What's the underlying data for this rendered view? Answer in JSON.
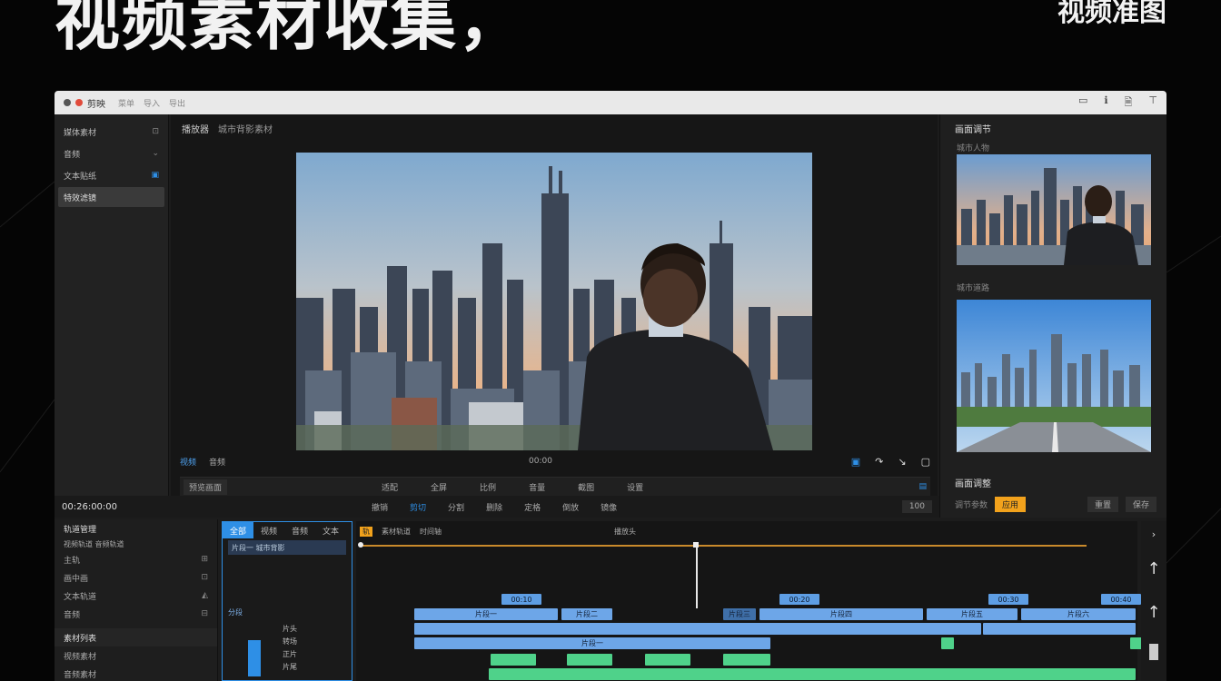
{
  "headline": "视频素材收集，",
  "corner_tag": "视频准图",
  "titlebar": {
    "app_name": "剪映",
    "menus": [
      "菜单",
      "导入",
      "导出"
    ],
    "right_icons": [
      "window-icon",
      "info-icon",
      "save-icon",
      "pin-icon"
    ]
  },
  "sidebar": {
    "items": [
      {
        "label": "媒体素材",
        "right": "⊡"
      },
      {
        "label": "音频",
        "right": "⌄"
      },
      {
        "label": "文本贴纸",
        "right": "▣"
      },
      {
        "label": "特效滤镜",
        "right": ""
      }
    ]
  },
  "preview": {
    "title": "播放器",
    "subtitle": "城市背影素材",
    "tab_active": "视频",
    "tab_other": "音频",
    "strip_label": "预览画面",
    "controls": [
      "适配",
      "全屏",
      "比例",
      "音量",
      "截图",
      "设置"
    ],
    "timecode_center": "00:00"
  },
  "right_panel": {
    "title": "画面调节",
    "thumb1_label": "城市人物",
    "thumb2_label": "城市道路",
    "bottom_title": "画面调整",
    "bottom_label": "调节参数",
    "bottom_btn_yellow": "应用",
    "bottom_btn_a": "重置",
    "bottom_btn_b": "保存"
  },
  "timeline_header": {
    "timecode": "00:26:00:00",
    "controls": [
      "撤销",
      "剪切",
      "分割",
      "删除",
      "定格",
      "倒放",
      "镜像"
    ],
    "volume": "100"
  },
  "tracks_left": {
    "head": "轨道管理",
    "subhead": "视频轨道 音频轨道",
    "rows": [
      {
        "label": "主轨",
        "right": "⊞"
      },
      {
        "label": "画中画",
        "right": "⊡"
      },
      {
        "label": "文本轨道",
        "right": "◭"
      },
      {
        "label": "音频",
        "right": "⊟"
      }
    ],
    "section2": "素材列表",
    "rows2": [
      {
        "label": "视频素材"
      },
      {
        "label": "音频素材"
      }
    ]
  },
  "tracks_mid": {
    "tabs": [
      "全部",
      "视频",
      "音频",
      "文本"
    ],
    "rows": [
      "片段一 城市背影"
    ],
    "section": "分段",
    "list": [
      "片头",
      "转场",
      "正片",
      "片尾"
    ]
  },
  "timeline": {
    "top_tag": "轨",
    "top_labels": [
      "素材轨道",
      "时间轴"
    ],
    "mid_label": "播放头",
    "markers": [
      "00:10",
      "00:20",
      "00:30",
      "00:40"
    ],
    "clip_labels": [
      "片段一",
      "片段二",
      "片段三",
      "片段四",
      "片段五",
      "片段六"
    ]
  },
  "colors": {
    "accent_blue": "#2e8fe6",
    "accent_yellow": "#f2a21c",
    "clip_blue": "#6da6e8",
    "clip_green": "#4fd28a"
  }
}
